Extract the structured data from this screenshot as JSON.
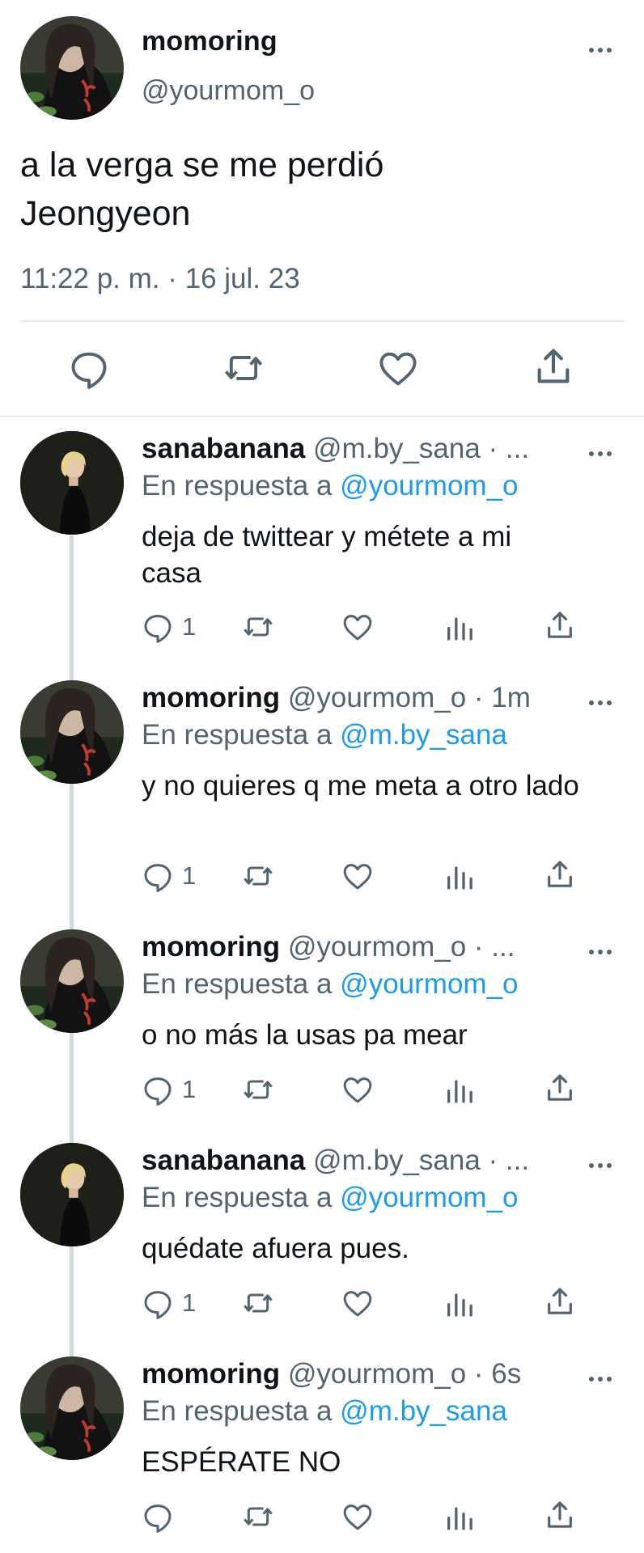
{
  "main_tweet": {
    "display_name": "momoring",
    "handle": "@yourmom_o",
    "text_line1": "a la verga se me perdió",
    "text_line2": "Jeongyeon",
    "timestamp": "11:22 p. m. · 16 jul. 23"
  },
  "replies": [
    {
      "display_name": "sanabanana",
      "meta": "@m.by_sana · ...",
      "reply_prefix": "En respuesta a",
      "reply_to": "@yourmom_o",
      "text": "deja de twittear y métete a mi casa",
      "reply_count": "1"
    },
    {
      "display_name": "momoring",
      "meta": "@yourmom_o · 1m",
      "reply_prefix": "En respuesta a",
      "reply_to": "@m.by_sana",
      "text": "y no quieres q me meta a otro lado",
      "reply_count": "1"
    },
    {
      "display_name": "momoring",
      "meta": "@yourmom_o · ...",
      "reply_prefix": "En respuesta a",
      "reply_to": "@yourmom_o",
      "text": "o no más la usas pa mear",
      "reply_count": "1"
    },
    {
      "display_name": "sanabanana",
      "meta": "@m.by_sana · ...",
      "reply_prefix": "En respuesta a",
      "reply_to": "@yourmom_o",
      "text": "quédate afuera pues.",
      "reply_count": "1"
    },
    {
      "display_name": "momoring",
      "meta": "@yourmom_o · 6s",
      "reply_prefix": "En respuesta a",
      "reply_to": "@m.by_sana",
      "text": "ESPÉRATE NO",
      "reply_count": ""
    }
  ],
  "icons": {
    "reply": "reply-icon",
    "retweet": "retweet-icon",
    "like": "heart-icon",
    "views": "views-icon",
    "share": "share-icon",
    "more": "more-icon"
  },
  "colors": {
    "link": "#1d9bf0",
    "secondary_text": "#536471",
    "primary_text": "#0f1419",
    "thread_line": "#cfd9de"
  }
}
